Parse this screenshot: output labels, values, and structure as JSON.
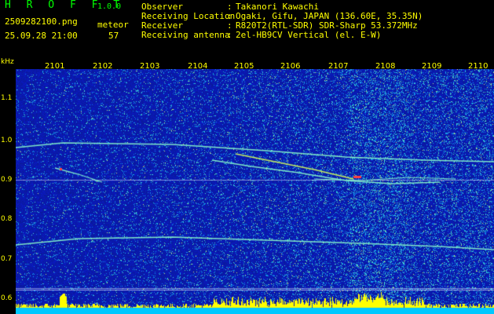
{
  "header": {
    "app_title": "H R O F F T",
    "app_version": "1.0.0",
    "file_name": "2509282100.png",
    "date_time": "25.09.28 21:00",
    "meteor_label": "meteor",
    "meteor_count": "57",
    "info": [
      {
        "label": "Observer",
        "value": "Takanori Kawachi"
      },
      {
        "label": "Receiving Location",
        "value": "Ogaki, Gifu, JAPAN (136.60E, 35.35N)"
      },
      {
        "label": "Receiver",
        "value": "R820T2(RTL-SDR) SDR-Sharp 53.372MHz"
      },
      {
        "label": "Receiving antenna",
        "value": "2el-HB9CV Vertical (el. E-W)"
      }
    ],
    "separator": ":"
  },
  "axis": {
    "y_unit": "kHz",
    "y_ticks": [
      "1.1",
      "1.0",
      "0.9",
      "0.8",
      "0.7",
      "0.6"
    ],
    "x_ticks": [
      "2101",
      "2102",
      "2103",
      "2104",
      "2105",
      "2106",
      "2107",
      "2108",
      "2109",
      "2110"
    ]
  },
  "colors": {
    "background": "#0a1fb0",
    "header_green": "#00ff00",
    "header_yellow": "#ffff00",
    "echo": "#7fe8c8",
    "strong_echo": "#ff4040"
  }
}
